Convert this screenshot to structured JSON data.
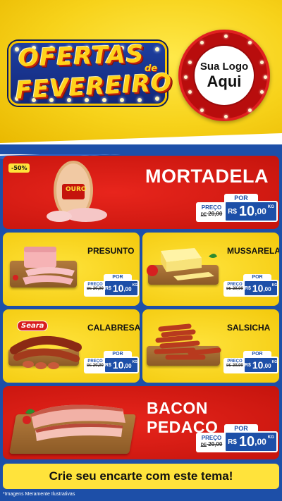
{
  "header": {
    "title_line1": "OFERTAS",
    "title_de": "de",
    "title_line2": "FEVEREIRO",
    "logo_line1": "Sua Logo",
    "logo_line2": "Aqui"
  },
  "products": [
    {
      "name": "MORTADELA",
      "badge": "-50%",
      "brand": "OURO",
      "por": "POR",
      "preco_label": "PREÇO",
      "old_prefix": "DE",
      "old_price": "20,00",
      "currency": "R$",
      "price_int": "10",
      "price_cents": ",00",
      "unit": "KG"
    },
    {
      "name": "PRESUNTO",
      "por": "POR",
      "preco_label": "PREÇO",
      "old_prefix": "DE",
      "old_price": "20,00",
      "currency": "R$",
      "price_int": "10",
      "price_cents": ",00",
      "unit": "KG"
    },
    {
      "name": "MUSSARELA",
      "por": "POR",
      "preco_label": "PREÇO",
      "old_prefix": "DE",
      "old_price": "20,00",
      "currency": "R$",
      "price_int": "10",
      "price_cents": ",00",
      "unit": "KG"
    },
    {
      "name": "CALABRESA",
      "brand": "Seara",
      "por": "POR",
      "preco_label": "PREÇO",
      "old_prefix": "DE",
      "old_price": "20,00",
      "currency": "R$",
      "price_int": "10",
      "price_cents": ",00",
      "unit": "KG"
    },
    {
      "name": "SALSICHA",
      "por": "POR",
      "preco_label": "PREÇO",
      "old_prefix": "DE",
      "old_price": "20,00",
      "currency": "R$",
      "price_int": "10",
      "price_cents": ",00",
      "unit": "KG"
    },
    {
      "name": "BACON PEDAÇO",
      "por": "POR",
      "preco_label": "PREÇO",
      "old_prefix": "DE",
      "old_price": "20,00",
      "currency": "R$",
      "price_int": "10",
      "price_cents": ",00",
      "unit": "KG"
    }
  ],
  "footer": {
    "cta": "Crie seu encarte com este tema!",
    "disclaimer": "*Imagens Meramente Ilustrativas"
  },
  "colors": {
    "red": "#d11a12",
    "yellow": "#f7d21a",
    "blue": "#1d4fa8"
  }
}
